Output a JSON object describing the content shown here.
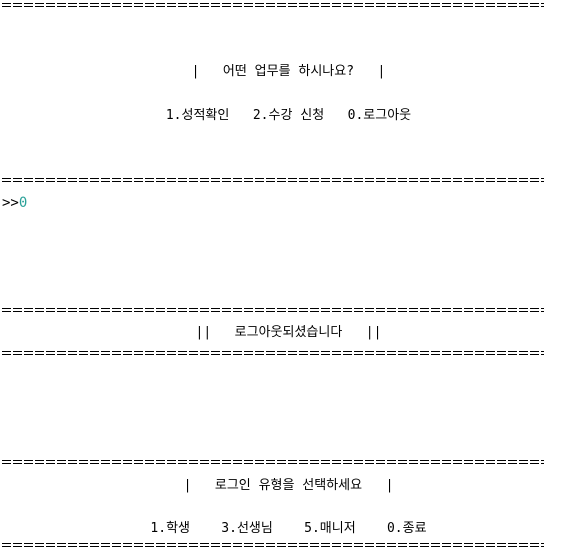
{
  "menu": {
    "title": "|   어떤 업무를 하시나요?   |",
    "options": "1.성적확인   2.수강 신청   0.로그아웃"
  },
  "input": {
    "prompt": ">>",
    "value": "0"
  },
  "logout": {
    "message": "||   로그아웃되셨습니다   ||"
  },
  "login": {
    "title": "|   로그인 유형을 선택하세요   |",
    "options": "1.학생    3.선생님    5.매니저    0.종료"
  },
  "colors": {
    "text": "#000000",
    "input_value": "#2aa198",
    "background": "#ffffff"
  }
}
